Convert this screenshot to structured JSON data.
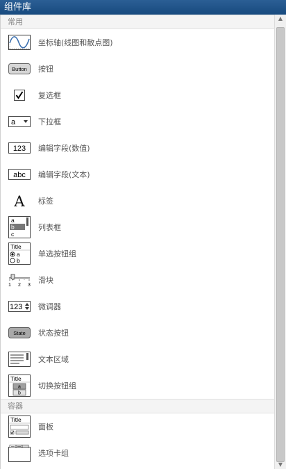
{
  "window": {
    "title": "组件库"
  },
  "sections": [
    {
      "header": "常用",
      "items": [
        {
          "label": "坐标轴(线图和散点图)",
          "icon": "axes-icon"
        },
        {
          "label": "按钮",
          "icon": "button-icon",
          "icon_text": "Button"
        },
        {
          "label": "复选框",
          "icon": "checkbox-icon"
        },
        {
          "label": "下拉框",
          "icon": "dropdown-icon",
          "icon_text": "a"
        },
        {
          "label": "编辑字段(数值)",
          "icon": "numeric-field-icon",
          "icon_text": "123"
        },
        {
          "label": "编辑字段(文本)",
          "icon": "text-field-icon",
          "icon_text": "abc"
        },
        {
          "label": "标签",
          "icon": "label-icon",
          "icon_text": "A"
        },
        {
          "label": "列表框",
          "icon": "listbox-icon",
          "icon_text": [
            "a",
            "b",
            "c"
          ]
        },
        {
          "label": "单选按钮组",
          "icon": "radio-group-icon",
          "icon_text": [
            "Title",
            "a",
            "b"
          ]
        },
        {
          "label": "滑块",
          "icon": "slider-icon",
          "icon_text": [
            "1",
            "2",
            "3"
          ]
        },
        {
          "label": "微调器",
          "icon": "spinner-icon",
          "icon_text": "123"
        },
        {
          "label": "状态按钮",
          "icon": "state-button-icon",
          "icon_text": "State"
        },
        {
          "label": "文本区域",
          "icon": "text-area-icon"
        },
        {
          "label": "切换按钮组",
          "icon": "toggle-group-icon",
          "icon_text": [
            "Title",
            "a",
            "b"
          ]
        }
      ]
    },
    {
      "header": "容器",
      "items": [
        {
          "label": "面板",
          "icon": "panel-icon",
          "icon_text": "Title"
        },
        {
          "label": "选项卡组",
          "icon": "tab-group-icon"
        }
      ]
    }
  ]
}
